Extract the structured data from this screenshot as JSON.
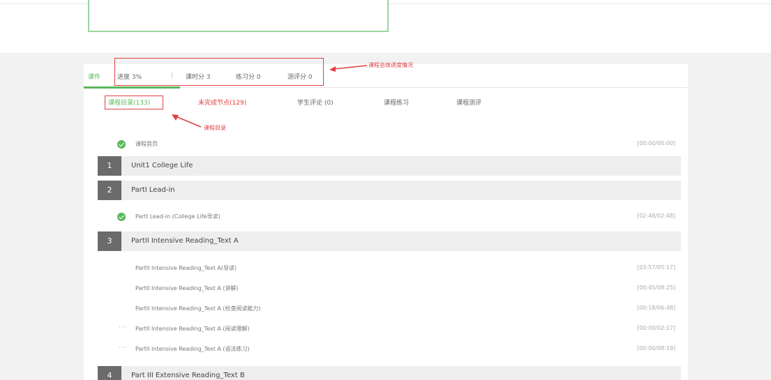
{
  "tabs": {
    "active": "课件",
    "items": [
      "进度 3%",
      "课时分 3",
      "练习分 0",
      "测评分 0"
    ]
  },
  "annotations": {
    "progress_note": "课程总体进度情况",
    "catalog_note": "课程目录"
  },
  "subtabs": [
    {
      "label": "课程目录(133)"
    },
    {
      "label": "未完成节点(129)"
    },
    {
      "label": "学生评论 (0)"
    },
    {
      "label": "课程练习"
    },
    {
      "label": "课程测评"
    }
  ],
  "rows": [
    {
      "type": "lesson",
      "status": "done",
      "title": "课程首页",
      "time": "[00:00/00:00]"
    },
    {
      "type": "chapter",
      "num": "1",
      "title": "Unit1 College Life"
    },
    {
      "type": "chapter",
      "num": "2",
      "title": "PartI Lead-in"
    },
    {
      "type": "lesson",
      "status": "done",
      "title": "PartI Lead-in (College Life导读)",
      "time": "[02:48/02:48]"
    },
    {
      "type": "chapter",
      "num": "3",
      "title": "PartII Intensive Reading_Text A"
    },
    {
      "type": "lesson",
      "status": "none",
      "title": "PartII Intensive Reading_Text A(导读)",
      "time": "[03:57/05:17]"
    },
    {
      "type": "lesson",
      "status": "none",
      "title": "PartII Intensive Reading_Text A (讲解)",
      "time": "[00:45/08:25]"
    },
    {
      "type": "lesson",
      "status": "none",
      "title": "PartII Intensive Reading_Text A (检查阅读能力)",
      "time": "[00:18/06:48]"
    },
    {
      "type": "lesson",
      "status": "pending",
      "title": "PartII Intensive Reading_Text A (阅读理解)",
      "time": "[00:00/02:17]"
    },
    {
      "type": "lesson",
      "status": "pending",
      "title": "PartII Intensive Reading_Text A (语法练习)",
      "time": "[00:00/08:19]"
    },
    {
      "type": "chapter",
      "num": "4",
      "title": "Part III Extensive Reading_Text B"
    }
  ],
  "colors": {
    "accent": "#5cb85c",
    "annotation": "#e04040",
    "chapter_num_bg": "#6b6b6b"
  }
}
